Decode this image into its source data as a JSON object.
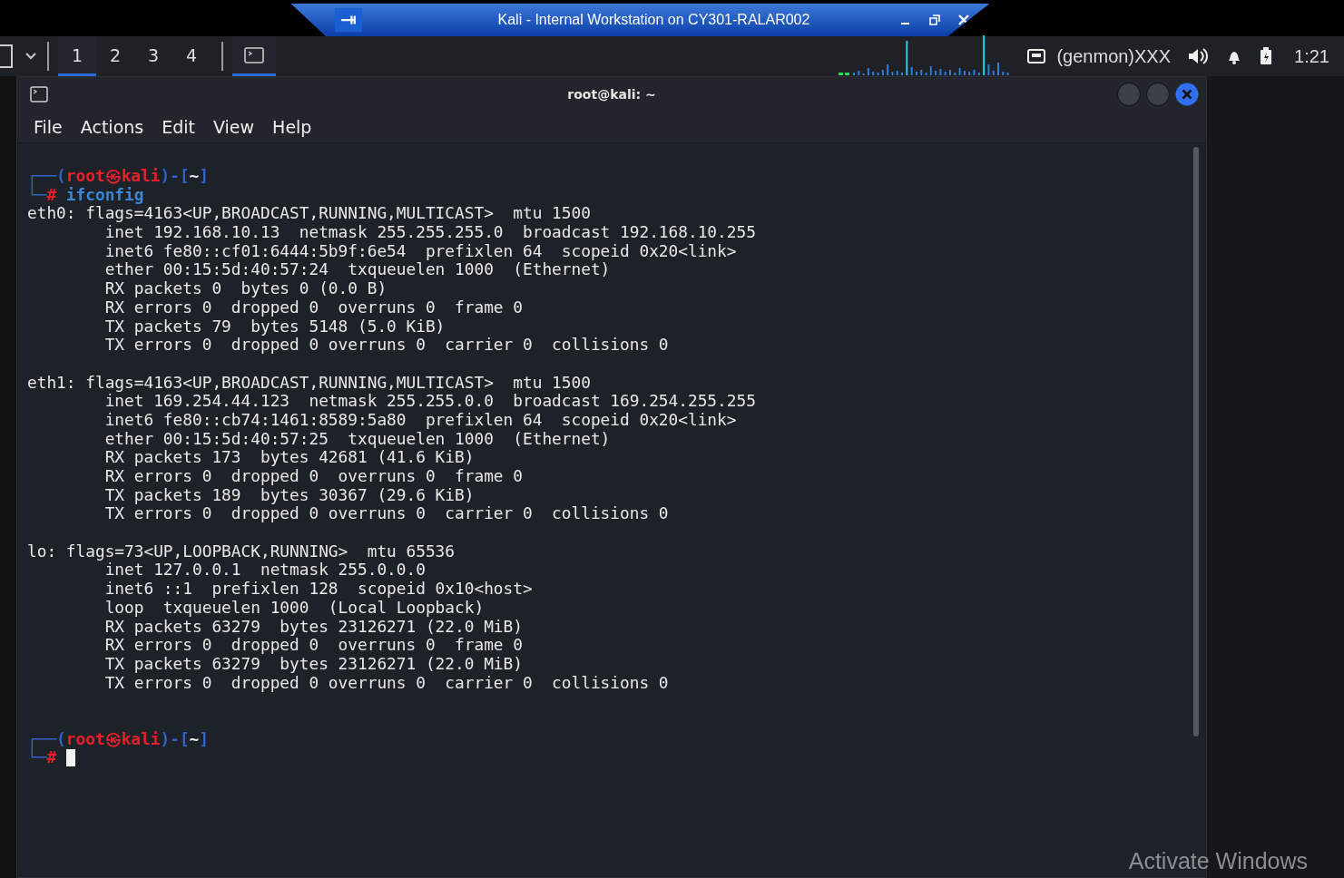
{
  "vm_bar": {
    "title": "Kali - Internal Workstation on CY301-RALAR002"
  },
  "panel": {
    "workspaces": [
      {
        "label": "1",
        "selected": true
      },
      {
        "label": "2",
        "selected": false
      },
      {
        "label": "3",
        "selected": false
      },
      {
        "label": "4",
        "selected": false
      }
    ],
    "genmon": "(genmon)XXX",
    "clock": "1:21"
  },
  "terminal": {
    "title": "root@kali: ~",
    "menu": [
      "File",
      "Actions",
      "Edit",
      "View",
      "Help"
    ],
    "lines": [
      {
        "kind": "prompt",
        "parts": [
          {
            "text": "┌──(",
            "color": "#3262c8"
          },
          {
            "text": "root㉿kali",
            "color": "#e8202a"
          },
          {
            "text": ")-[",
            "color": "#3262c8"
          },
          {
            "text": "~",
            "color": "#e8e8e8"
          },
          {
            "text": "]",
            "color": "#3262c8"
          }
        ]
      },
      {
        "kind": "prompt",
        "parts": [
          {
            "text": "└─",
            "color": "#3262c8"
          },
          {
            "text": "#",
            "color": "#e8202a"
          },
          {
            "text": " ifconfig",
            "color": "#3a86d8"
          }
        ]
      },
      {
        "kind": "output",
        "text": "eth0: flags=4163<UP,BROADCAST,RUNNING,MULTICAST>  mtu 1500"
      },
      {
        "kind": "output",
        "text": "        inet 192.168.10.13  netmask 255.255.255.0  broadcast 192.168.10.255"
      },
      {
        "kind": "output",
        "text": "        inet6 fe80::cf01:6444:5b9f:6e54  prefixlen 64  scopeid 0x20<link>"
      },
      {
        "kind": "output",
        "text": "        ether 00:15:5d:40:57:24  txqueuelen 1000  (Ethernet)"
      },
      {
        "kind": "output",
        "text": "        RX packets 0  bytes 0 (0.0 B)"
      },
      {
        "kind": "output",
        "text": "        RX errors 0  dropped 0  overruns 0  frame 0"
      },
      {
        "kind": "output",
        "text": "        TX packets 79  bytes 5148 (5.0 KiB)"
      },
      {
        "kind": "output",
        "text": "        TX errors 0  dropped 0 overruns 0  carrier 0  collisions 0"
      },
      {
        "kind": "blank"
      },
      {
        "kind": "output",
        "text": "eth1: flags=4163<UP,BROADCAST,RUNNING,MULTICAST>  mtu 1500"
      },
      {
        "kind": "output",
        "text": "        inet 169.254.44.123  netmask 255.255.0.0  broadcast 169.254.255.255"
      },
      {
        "kind": "output",
        "text": "        inet6 fe80::cb74:1461:8589:5a80  prefixlen 64  scopeid 0x20<link>"
      },
      {
        "kind": "output",
        "text": "        ether 00:15:5d:40:57:25  txqueuelen 1000  (Ethernet)"
      },
      {
        "kind": "output",
        "text": "        RX packets 173  bytes 42681 (41.6 KiB)"
      },
      {
        "kind": "output",
        "text": "        RX errors 0  dropped 0  overruns 0  frame 0"
      },
      {
        "kind": "output",
        "text": "        TX packets 189  bytes 30367 (29.6 KiB)"
      },
      {
        "kind": "output",
        "text": "        TX errors 0  dropped 0 overruns 0  carrier 0  collisions 0"
      },
      {
        "kind": "blank"
      },
      {
        "kind": "output",
        "text": "lo: flags=73<UP,LOOPBACK,RUNNING>  mtu 65536"
      },
      {
        "kind": "output",
        "text": "        inet 127.0.0.1  netmask 255.0.0.0"
      },
      {
        "kind": "output",
        "text": "        inet6 ::1  prefixlen 128  scopeid 0x10<host>"
      },
      {
        "kind": "output",
        "text": "        loop  txqueuelen 1000  (Local Loopback)"
      },
      {
        "kind": "output",
        "text": "        RX packets 63279  bytes 23126271 (22.0 MiB)"
      },
      {
        "kind": "output",
        "text": "        RX errors 0  dropped 0  overruns 0  frame 0"
      },
      {
        "kind": "output",
        "text": "        TX packets 63279  bytes 23126271 (22.0 MiB)"
      },
      {
        "kind": "output",
        "text": "        TX errors 0  dropped 0 overruns 0  carrier 0  collisions 0"
      },
      {
        "kind": "blank"
      },
      {
        "kind": "blank"
      },
      {
        "kind": "prompt",
        "parts": [
          {
            "text": "┌──(",
            "color": "#3262c8"
          },
          {
            "text": "root㉿kali",
            "color": "#e8202a"
          },
          {
            "text": ")-[",
            "color": "#3262c8"
          },
          {
            "text": "~",
            "color": "#e8e8e8"
          },
          {
            "text": "]",
            "color": "#3262c8"
          }
        ]
      },
      {
        "kind": "prompt",
        "cursor": true,
        "parts": [
          {
            "text": "└─",
            "color": "#3262c8"
          },
          {
            "text": "#",
            "color": "#e8202a"
          }
        ]
      }
    ]
  },
  "overlay": {
    "notice": "Activate Windows"
  }
}
